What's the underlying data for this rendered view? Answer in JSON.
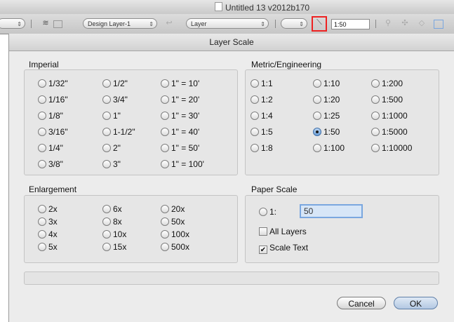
{
  "app": {
    "title": "Untitled 13 v2012b170"
  },
  "toolbar": {
    "layer_select": "Design Layer-1",
    "class_select": "Layer",
    "scale_value": "1:50"
  },
  "dialog": {
    "title": "Layer Scale",
    "imperial": {
      "label": "Imperial",
      "options": [
        "1/32\"",
        "1/16\"",
        "1/8\"",
        "3/16\"",
        "1/4\"",
        "3/8\"",
        "1/2\"",
        "3/4\"",
        "1\"",
        "1-1/2\"",
        "2\"",
        "3\"",
        "1\" = 10'",
        "1\" = 20'",
        "1\" = 30'",
        "1\" = 40'",
        "1\" = 50'",
        "1\" = 100'"
      ]
    },
    "metric": {
      "label": "Metric/Engineering",
      "options": [
        "1:1",
        "1:2",
        "1:4",
        "1:5",
        "1:8",
        "1:10",
        "1:20",
        "1:25",
        "1:50",
        "1:100",
        "1:200",
        "1:500",
        "1:1000",
        "1:5000",
        "1:10000"
      ],
      "selected": "1:50"
    },
    "enlargement": {
      "label": "Enlargement",
      "options": [
        "2x",
        "3x",
        "4x",
        "5x",
        "6x",
        "8x",
        "10x",
        "15x",
        "20x",
        "50x",
        "100x",
        "500x"
      ]
    },
    "paper_scale": {
      "label": "Paper Scale",
      "radio_label": "1:",
      "value": "50",
      "all_layers_label": "All Layers",
      "all_layers_checked": false,
      "scale_text_label": "Scale Text",
      "scale_text_checked": true
    },
    "buttons": {
      "cancel": "Cancel",
      "ok": "OK"
    }
  }
}
